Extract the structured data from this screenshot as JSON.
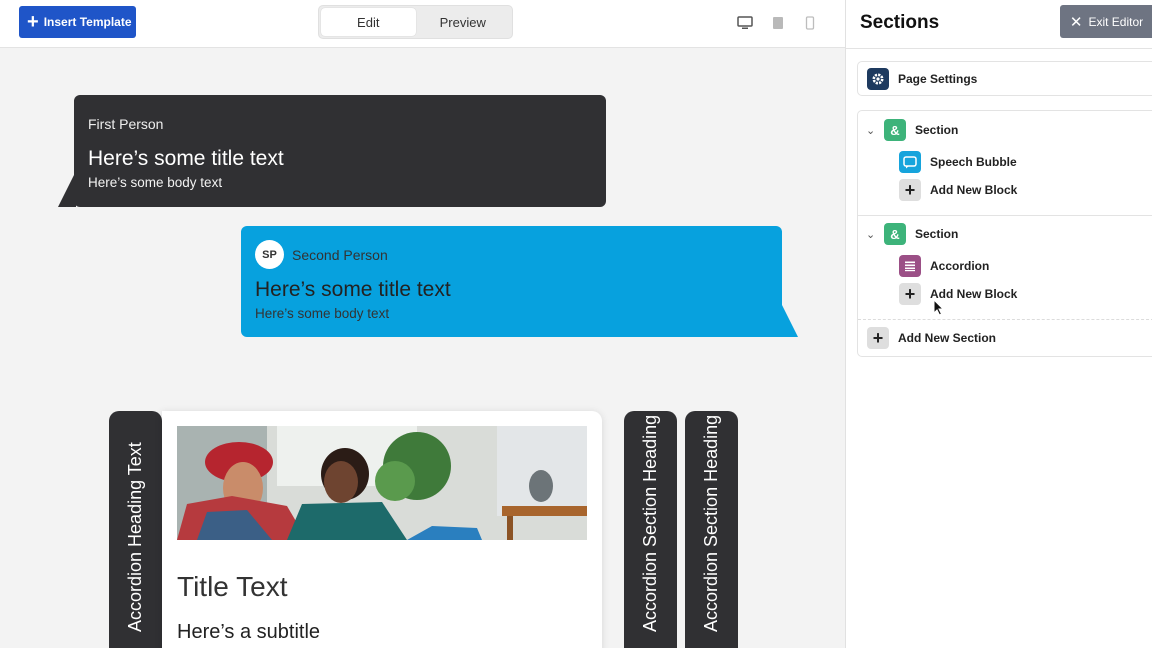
{
  "toolbar": {
    "insert_template_label": "Insert Template",
    "modes": [
      "Edit",
      "Preview"
    ],
    "active_mode": "Edit",
    "devices": [
      "desktop-icon",
      "tablet-icon",
      "mobile-icon"
    ]
  },
  "canvas": {
    "bubble_first": {
      "speaker": "First Person",
      "title": "Here’s some title text",
      "body": "Here’s some body text"
    },
    "bubble_second": {
      "avatar_initials": "SP",
      "speaker": "Second Person",
      "title": "Here’s some title text",
      "body": "Here’s some body text"
    },
    "accordion": {
      "heading_text": "Accordion Heading Text",
      "card_title": "Title Text",
      "card_subtitle": "Here’s a subtitle",
      "section_headings": [
        "Accordion Section Heading",
        "Accordion Section Heading"
      ]
    }
  },
  "panel": {
    "title": "Sections",
    "exit_label": "Exit Editor",
    "page_settings_label": "Page Settings",
    "sections": [
      {
        "label": "Section",
        "blocks": [
          {
            "label": "Speech Bubble",
            "icon": "speech-bubble-icon"
          }
        ],
        "add_block_label": "Add New Block"
      },
      {
        "label": "Section",
        "blocks": [
          {
            "label": "Accordion",
            "icon": "accordion-icon"
          }
        ],
        "add_block_label": "Add New Block"
      }
    ],
    "add_section_label": "Add New Section"
  },
  "colors": {
    "primary_blue": "#1f55c8",
    "bubble_dark": "#303033",
    "bubble_blue": "#07a1de",
    "section_green": "#3db37a",
    "accordion_purple": "#9b4f86",
    "exit_gray": "#6e7482"
  }
}
